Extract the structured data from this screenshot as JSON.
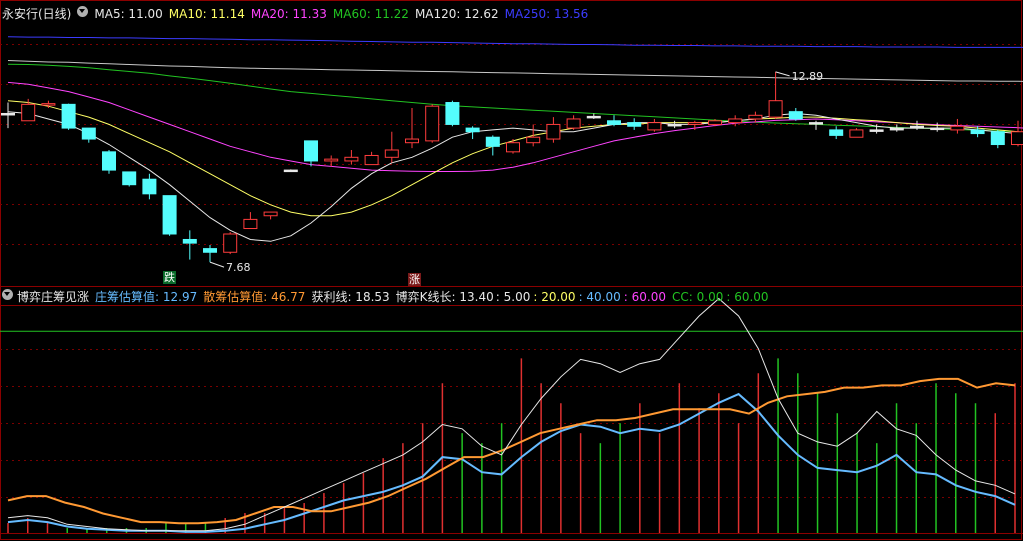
{
  "colors": {
    "up": "#ff3d3d",
    "down": "#54fcfc",
    "ma5": "#e8e8e8",
    "ma10": "#ffff66",
    "ma20": "#ff44ff",
    "ma60": "#22c322",
    "ma120": "#c8c8c8",
    "ma250": "#3c3cff",
    "zhuang": "#66bbff",
    "san": "#ff9933",
    "huoli": "#e8e8e8",
    "boyi": "#e8e8e8",
    "cc": "#22c322"
  },
  "panel1": {
    "title": "永安行(日线)",
    "ma5": "MA5: 11.00",
    "ma10": "MA10: 11.14",
    "ma20": "MA20: 11.33",
    "ma60": "MA60: 11.22",
    "ma120": "MA120: 12.62",
    "ma250": "MA250: 13.56",
    "high_label": "12.89",
    "low_label": "7.68",
    "tag_die": "跌",
    "tag_zhang": "涨"
  },
  "panel2": {
    "title": "博弈庄筹见涨",
    "zhuang": "庄筹估算值: 12.97",
    "san": "散筹估算值: 46.77",
    "huoli": "获利线: 18.53",
    "boyi": "博弈K线长: 13.40",
    "p5": ": 5.00",
    "p20": ": 20.00",
    "p40": ": 40.00",
    "p60": ": 60.00",
    "cc": "CC: 0.00",
    "cc60": ": 60.00"
  },
  "chart_data": [
    {
      "type": "candlestick",
      "title": "永安行(日线)",
      "candles": [
        {
          "o": 11.75,
          "h": 12.05,
          "l": 11.35,
          "c": 11.75,
          "dir": "flat"
        },
        {
          "o": 11.55,
          "h": 12.15,
          "l": 11.55,
          "c": 12.0,
          "dir": "up"
        },
        {
          "o": 12.0,
          "h": 12.1,
          "l": 11.9,
          "c": 12.02,
          "dir": "up"
        },
        {
          "o": 12.0,
          "h": 12.02,
          "l": 11.3,
          "c": 11.35,
          "dir": "down"
        },
        {
          "o": 11.35,
          "h": 11.35,
          "l": 10.95,
          "c": 11.05,
          "dir": "down"
        },
        {
          "o": 10.7,
          "h": 10.75,
          "l": 10.1,
          "c": 10.2,
          "dir": "down"
        },
        {
          "o": 10.15,
          "h": 10.15,
          "l": 9.75,
          "c": 9.8,
          "dir": "down"
        },
        {
          "o": 9.95,
          "h": 10.1,
          "l": 9.4,
          "c": 9.55,
          "dir": "down"
        },
        {
          "o": 9.5,
          "h": 9.5,
          "l": 8.4,
          "c": 8.45,
          "dir": "down"
        },
        {
          "o": 8.3,
          "h": 8.55,
          "l": 7.75,
          "c": 8.2,
          "dir": "down"
        },
        {
          "o": 8.05,
          "h": 8.15,
          "l": 7.68,
          "c": 7.95,
          "dir": "down"
        },
        {
          "o": 7.95,
          "h": 8.5,
          "l": 7.9,
          "c": 8.45,
          "dir": "up"
        },
        {
          "o": 8.6,
          "h": 9.05,
          "l": 8.6,
          "c": 8.85,
          "dir": "up"
        },
        {
          "o": 8.95,
          "h": 9.05,
          "l": 8.85,
          "c": 9.05,
          "dir": "up"
        },
        {
          "o": 10.2,
          "h": 10.22,
          "l": 10.18,
          "c": 10.2,
          "dir": "flat"
        },
        {
          "o": 11.0,
          "h": 11.0,
          "l": 10.3,
          "c": 10.45,
          "dir": "down"
        },
        {
          "o": 10.45,
          "h": 10.6,
          "l": 10.3,
          "c": 10.5,
          "dir": "up"
        },
        {
          "o": 10.45,
          "h": 10.75,
          "l": 10.35,
          "c": 10.55,
          "dir": "up"
        },
        {
          "o": 10.35,
          "h": 10.7,
          "l": 10.35,
          "c": 10.6,
          "dir": "up"
        },
        {
          "o": 10.55,
          "h": 11.25,
          "l": 10.4,
          "c": 10.75,
          "dir": "up"
        },
        {
          "o": 10.95,
          "h": 11.9,
          "l": 10.8,
          "c": 11.05,
          "dir": "up"
        },
        {
          "o": 11.0,
          "h": 12.0,
          "l": 10.95,
          "c": 11.95,
          "dir": "up"
        },
        {
          "o": 12.05,
          "h": 12.1,
          "l": 11.4,
          "c": 11.45,
          "dir": "down"
        },
        {
          "o": 11.35,
          "h": 11.4,
          "l": 11.05,
          "c": 11.25,
          "dir": "down"
        },
        {
          "o": 11.1,
          "h": 11.15,
          "l": 10.6,
          "c": 10.85,
          "dir": "down"
        },
        {
          "o": 10.7,
          "h": 11.05,
          "l": 10.65,
          "c": 10.95,
          "dir": "up"
        },
        {
          "o": 10.95,
          "h": 11.45,
          "l": 10.85,
          "c": 11.1,
          "dir": "up"
        },
        {
          "o": 11.05,
          "h": 11.65,
          "l": 10.95,
          "c": 11.45,
          "dir": "up"
        },
        {
          "o": 11.35,
          "h": 11.7,
          "l": 11.3,
          "c": 11.6,
          "dir": "up"
        },
        {
          "o": 11.65,
          "h": 11.75,
          "l": 11.6,
          "c": 11.67,
          "dir": "flat"
        },
        {
          "o": 11.55,
          "h": 11.7,
          "l": 11.4,
          "c": 11.45,
          "dir": "down"
        },
        {
          "o": 11.5,
          "h": 11.62,
          "l": 11.3,
          "c": 11.4,
          "dir": "down"
        },
        {
          "o": 11.3,
          "h": 11.6,
          "l": 11.25,
          "c": 11.5,
          "dir": "up"
        },
        {
          "o": 11.45,
          "h": 11.55,
          "l": 11.35,
          "c": 11.45,
          "dir": "flat"
        },
        {
          "o": 11.45,
          "h": 11.55,
          "l": 11.3,
          "c": 11.5,
          "dir": "up"
        },
        {
          "o": 11.45,
          "h": 11.6,
          "l": 11.4,
          "c": 11.55,
          "dir": "up"
        },
        {
          "o": 11.5,
          "h": 11.7,
          "l": 11.4,
          "c": 11.6,
          "dir": "up"
        },
        {
          "o": 11.6,
          "h": 11.8,
          "l": 11.5,
          "c": 11.7,
          "dir": "up"
        },
        {
          "o": 11.65,
          "h": 12.89,
          "l": 11.6,
          "c": 12.1,
          "dir": "up"
        },
        {
          "o": 11.8,
          "h": 11.9,
          "l": 11.55,
          "c": 11.6,
          "dir": "down"
        },
        {
          "o": 11.5,
          "h": 11.55,
          "l": 11.3,
          "c": 11.5,
          "dir": "flat"
        },
        {
          "o": 11.3,
          "h": 11.4,
          "l": 11.05,
          "c": 11.15,
          "dir": "down"
        },
        {
          "o": 11.1,
          "h": 11.35,
          "l": 11.1,
          "c": 11.3,
          "dir": "up"
        },
        {
          "o": 11.3,
          "h": 11.45,
          "l": 11.2,
          "c": 11.28,
          "dir": "flat"
        },
        {
          "o": 11.3,
          "h": 11.45,
          "l": 11.25,
          "c": 11.35,
          "dir": "flat"
        },
        {
          "o": 11.4,
          "h": 11.55,
          "l": 11.3,
          "c": 11.35,
          "dir": "flat"
        },
        {
          "o": 11.35,
          "h": 11.5,
          "l": 11.25,
          "c": 11.32,
          "dir": "flat"
        },
        {
          "o": 11.3,
          "h": 11.6,
          "l": 11.2,
          "c": 11.4,
          "dir": "up"
        },
        {
          "o": 11.3,
          "h": 11.4,
          "l": 11.1,
          "c": 11.2,
          "dir": "down"
        },
        {
          "o": 11.25,
          "h": 11.3,
          "l": 10.8,
          "c": 10.9,
          "dir": "down"
        },
        {
          "o": 10.9,
          "h": 11.55,
          "l": 10.85,
          "c": 11.25,
          "dir": "up"
        },
        {
          "o": 11.25,
          "h": 11.4,
          "l": 10.9,
          "c": 11.0,
          "dir": "down"
        }
      ],
      "ma5": [
        11.8,
        11.75,
        11.6,
        11.45,
        11.2,
        10.9,
        10.55,
        10.2,
        9.8,
        9.35,
        8.9,
        8.55,
        8.3,
        8.25,
        8.4,
        8.75,
        9.2,
        9.7,
        10.1,
        10.4,
        10.55,
        10.8,
        11.1,
        11.25,
        11.3,
        11.35,
        11.3,
        11.25,
        11.25,
        11.35,
        11.45,
        11.5,
        11.5,
        11.45,
        11.45,
        11.5,
        11.55,
        11.6,
        11.7,
        11.75,
        11.7,
        11.6,
        11.5,
        11.4,
        11.35,
        11.35,
        11.35,
        11.35,
        11.3,
        11.25,
        11.2,
        11.0
      ],
      "ma10": [
        12.1,
        12.05,
        11.95,
        11.8,
        11.65,
        11.45,
        11.2,
        10.95,
        10.7,
        10.4,
        10.1,
        9.8,
        9.5,
        9.25,
        9.05,
        8.95,
        8.95,
        9.05,
        9.25,
        9.5,
        9.8,
        10.1,
        10.4,
        10.65,
        10.85,
        11.0,
        11.15,
        11.25,
        11.35,
        11.4,
        11.45,
        11.45,
        11.5,
        11.5,
        11.5,
        11.5,
        11.55,
        11.6,
        11.62,
        11.65,
        11.65,
        11.62,
        11.58,
        11.55,
        11.5,
        11.45,
        11.42,
        11.4,
        11.35,
        11.3,
        11.25,
        11.14
      ],
      "ma20": [
        12.6,
        12.55,
        12.45,
        12.35,
        12.2,
        12.05,
        11.85,
        11.65,
        11.45,
        11.25,
        11.05,
        10.85,
        10.7,
        10.55,
        10.45,
        10.35,
        10.3,
        10.25,
        10.2,
        10.18,
        10.17,
        10.16,
        10.16,
        10.17,
        10.2,
        10.28,
        10.4,
        10.55,
        10.7,
        10.85,
        11.0,
        11.1,
        11.2,
        11.28,
        11.35,
        11.42,
        11.48,
        11.52,
        11.56,
        11.58,
        11.6,
        11.58,
        11.55,
        11.52,
        11.5,
        11.47,
        11.44,
        11.42,
        11.4,
        11.38,
        11.36,
        11.33
      ],
      "ma60": [
        13.1,
        13.09,
        13.07,
        13.04,
        13.0,
        12.95,
        12.9,
        12.85,
        12.78,
        12.72,
        12.65,
        12.58,
        12.5,
        12.42,
        12.35,
        12.3,
        12.25,
        12.2,
        12.15,
        12.1,
        12.05,
        12.0,
        11.96,
        11.93,
        11.9,
        11.87,
        11.84,
        11.81,
        11.78,
        11.75,
        11.72,
        11.69,
        11.66,
        11.63,
        11.6,
        11.57,
        11.54,
        11.51,
        11.49,
        11.47,
        11.45,
        11.43,
        11.41,
        11.39,
        11.37,
        11.35,
        11.33,
        11.31,
        11.29,
        11.27,
        11.25,
        11.22
      ],
      "ma120": [
        13.2,
        13.18,
        13.16,
        13.15,
        13.13,
        13.11,
        13.09,
        13.07,
        13.05,
        13.04,
        13.02,
        13.0,
        12.99,
        12.98,
        12.97,
        12.96,
        12.95,
        12.94,
        12.93,
        12.92,
        12.91,
        12.9,
        12.89,
        12.88,
        12.87,
        12.86,
        12.85,
        12.84,
        12.83,
        12.82,
        12.81,
        12.8,
        12.79,
        12.78,
        12.77,
        12.76,
        12.75,
        12.74,
        12.73,
        12.72,
        12.71,
        12.7,
        12.69,
        12.68,
        12.67,
        12.66,
        12.65,
        12.64,
        12.64,
        12.63,
        12.63,
        12.62
      ],
      "ma250": [
        13.85,
        13.84,
        13.84,
        13.83,
        13.83,
        13.82,
        13.82,
        13.81,
        13.8,
        13.8,
        13.79,
        13.78,
        13.77,
        13.77,
        13.76,
        13.75,
        13.74,
        13.73,
        13.72,
        13.71,
        13.7,
        13.7,
        13.69,
        13.68,
        13.67,
        13.66,
        13.66,
        13.65,
        13.64,
        13.64,
        13.63,
        13.62,
        13.62,
        13.61,
        13.61,
        13.6,
        13.6,
        13.59,
        13.59,
        13.59,
        13.58,
        13.58,
        13.58,
        13.57,
        13.57,
        13.57,
        13.57,
        13.56,
        13.56,
        13.56,
        13.56,
        13.56
      ],
      "ylim": [
        7.3,
        14.2
      ],
      "markers": [
        {
          "index": 9,
          "label": "跌"
        },
        {
          "index": 20,
          "label": "涨"
        }
      ]
    },
    {
      "type": "line",
      "title": "博弈庄筹见涨",
      "series": [
        {
          "name": "庄筹估算值",
          "values": [
            5,
            6,
            5,
            3,
            2,
            1.5,
            1,
            1,
            1,
            0.5,
            0.5,
            1,
            2,
            4,
            6,
            9,
            12,
            15,
            17,
            19,
            22,
            26,
            35,
            34,
            28,
            27,
            35,
            42,
            47,
            50,
            49,
            46,
            48,
            47,
            50,
            55,
            60,
            64,
            56,
            45,
            36,
            30,
            29,
            28,
            31,
            36,
            28,
            27,
            22,
            19,
            17,
            13
          ]
        },
        {
          "name": "散筹估算值",
          "values": [
            15,
            17,
            17,
            14,
            12,
            9,
            7,
            5,
            5,
            4.5,
            4.5,
            5,
            6,
            9,
            12,
            12,
            10,
            10,
            12,
            14,
            17,
            21,
            25,
            30,
            35,
            35,
            38,
            42,
            46,
            48,
            50,
            52,
            52,
            53,
            55,
            57,
            57,
            57,
            57,
            55,
            60,
            63,
            64,
            65,
            67,
            67,
            68,
            68,
            70,
            71,
            71,
            67,
            69,
            68
          ]
        },
        {
          "name": "获利线",
          "values": [
            7,
            8,
            7,
            4,
            3,
            2,
            1.5,
            1,
            1,
            1,
            1,
            2,
            4,
            8,
            12,
            16,
            20,
            24,
            28,
            32,
            36,
            42,
            50,
            48,
            40,
            36,
            50,
            62,
            72,
            80,
            78,
            74,
            78,
            80,
            90,
            100,
            108,
            100,
            85,
            62,
            46,
            42,
            40,
            46,
            56,
            48,
            45,
            36,
            29,
            24,
            22,
            18
          ]
        }
      ],
      "cc_line": 93,
      "ylim": [
        0,
        100
      ],
      "bars": [
        {
          "v": 2,
          "c": "up"
        },
        {
          "v": 3,
          "c": "up"
        },
        {
          "v": 2,
          "c": "up"
        },
        {
          "v": 1,
          "c": "dn"
        },
        {
          "v": 1,
          "c": "dn"
        },
        {
          "v": 1,
          "c": "dn"
        },
        {
          "v": 1,
          "c": "dn"
        },
        {
          "v": 1,
          "c": "dn"
        },
        {
          "v": 2,
          "c": "dn"
        },
        {
          "v": 2,
          "c": "dn"
        },
        {
          "v": 2,
          "c": "dn"
        },
        {
          "v": 3,
          "c": "up"
        },
        {
          "v": 4,
          "c": "up"
        },
        {
          "v": 4,
          "c": "up"
        },
        {
          "v": 5,
          "c": "up"
        },
        {
          "v": 6,
          "c": "up"
        },
        {
          "v": 8,
          "c": "up"
        },
        {
          "v": 10,
          "c": "up"
        },
        {
          "v": 12,
          "c": "up"
        },
        {
          "v": 15,
          "c": "up"
        },
        {
          "v": 18,
          "c": "up"
        },
        {
          "v": 22,
          "c": "up"
        },
        {
          "v": 30,
          "c": "up"
        },
        {
          "v": 20,
          "c": "dn"
        },
        {
          "v": 18,
          "c": "dn"
        },
        {
          "v": 22,
          "c": "dn"
        },
        {
          "v": 35,
          "c": "up"
        },
        {
          "v": 30,
          "c": "up"
        },
        {
          "v": 26,
          "c": "up"
        },
        {
          "v": 20,
          "c": "up"
        },
        {
          "v": 18,
          "c": "dn"
        },
        {
          "v": 22,
          "c": "dn"
        },
        {
          "v": 26,
          "c": "up"
        },
        {
          "v": 20,
          "c": "up"
        },
        {
          "v": 30,
          "c": "up"
        },
        {
          "v": 25,
          "c": "up"
        },
        {
          "v": 28,
          "c": "up"
        },
        {
          "v": 22,
          "c": "up"
        },
        {
          "v": 32,
          "c": "up"
        },
        {
          "v": 35,
          "c": "dn"
        },
        {
          "v": 32,
          "c": "dn"
        },
        {
          "v": 28,
          "c": "dn"
        },
        {
          "v": 24,
          "c": "dn"
        },
        {
          "v": 20,
          "c": "dn"
        },
        {
          "v": 18,
          "c": "dn"
        },
        {
          "v": 26,
          "c": "dn"
        },
        {
          "v": 22,
          "c": "dn"
        },
        {
          "v": 30,
          "c": "dn"
        },
        {
          "v": 28,
          "c": "dn"
        },
        {
          "v": 26,
          "c": "dn"
        },
        {
          "v": 24,
          "c": "up"
        },
        {
          "v": 30,
          "c": "up"
        }
      ]
    }
  ]
}
